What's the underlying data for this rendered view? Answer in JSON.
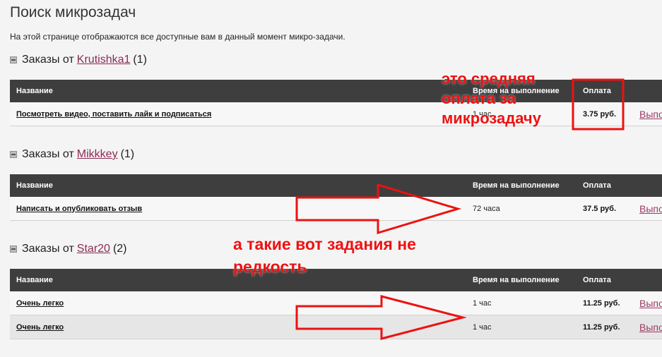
{
  "page": {
    "title": "Поиск микрозадач",
    "description": "На этой странице отображаются все доступные вам в данный момент микро-задачи."
  },
  "groups": [
    {
      "prefix": "Заказы от",
      "user": "Krutishka1",
      "count": "(1)",
      "columns": [
        "Название",
        "Время на выполнение",
        "Оплата",
        ""
      ],
      "rows": [
        {
          "title": "Посмотреть видео, поставить лайк и подписаться",
          "time": "1 час",
          "pay": "3.75 руб.",
          "action": "Выполнить"
        }
      ]
    },
    {
      "prefix": "Заказы от",
      "user": "Mikkkey",
      "count": "(1)",
      "columns": [
        "Название",
        "Время на выполнение",
        "Оплата",
        ""
      ],
      "rows": [
        {
          "title": "Написать и опубликовать отзыв",
          "time": "72 часа",
          "pay": "37.5 руб.",
          "action": "Выполнить"
        }
      ]
    },
    {
      "prefix": "Заказы от",
      "user": "Star20",
      "count": "(2)",
      "columns": [
        "Название",
        "Время на выполнение",
        "Оплата",
        ""
      ],
      "rows": [
        {
          "title": "Очень легко",
          "time": "1 час",
          "pay": "11.25 руб.",
          "action": "Выполнить"
        },
        {
          "title": "Очень легко",
          "time": "1 час",
          "pay": "11.25 руб.",
          "action": "Выполнить"
        }
      ]
    }
  ],
  "annotations": {
    "payment_note": [
      "это средняя",
      "оплата за",
      "микрозадачу"
    ],
    "tasks_note": [
      "а такие вот задания не",
      "редкость"
    ],
    "color": "#ee1111"
  }
}
